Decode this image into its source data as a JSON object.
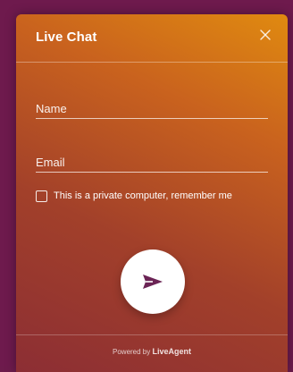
{
  "widget": {
    "title": "Live Chat",
    "close_icon": "close-icon"
  },
  "form": {
    "name_placeholder": "Name",
    "email_placeholder": "Email",
    "remember_label": "This is a private computer, remember me",
    "send_icon": "send-icon"
  },
  "footer": {
    "powered_text": "Powered by",
    "brand": "LiveAgent"
  },
  "colors": {
    "page_background": "#6e1a4d",
    "gradient_start": "#e08a10",
    "gradient_end": "#8c2e34",
    "send_icon_color": "#6b2455"
  }
}
